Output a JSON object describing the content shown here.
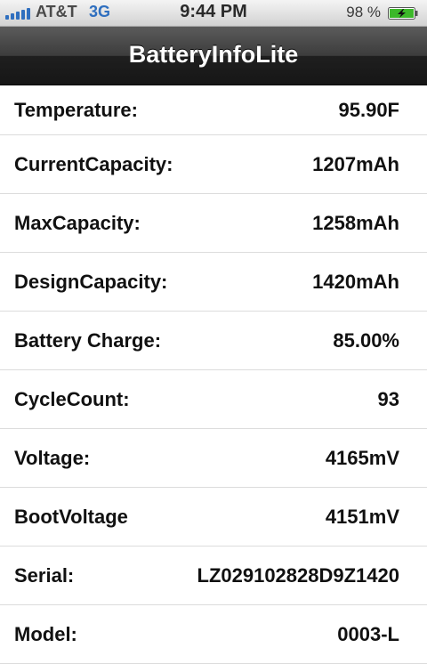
{
  "status_bar": {
    "carrier": "AT&T",
    "network": "3G",
    "time": "9:44 PM",
    "battery_percent": "98 %",
    "icons": [
      "signal-bars-icon",
      "battery-charging-icon"
    ]
  },
  "nav": {
    "title": "BatteryInfoLite"
  },
  "rows": [
    {
      "label": "Temperature:",
      "value": "95.90F"
    },
    {
      "label": "CurrentCapacity:",
      "value": "1207mAh"
    },
    {
      "label": "MaxCapacity:",
      "value": "1258mAh"
    },
    {
      "label": "DesignCapacity:",
      "value": "1420mAh"
    },
    {
      "label": "Battery Charge:",
      "value": "85.00%"
    },
    {
      "label": "CycleCount:",
      "value": "93"
    },
    {
      "label": "Voltage:",
      "value": "4165mV"
    },
    {
      "label": "BootVoltage",
      "value": "4151mV"
    },
    {
      "label": "Serial:",
      "value": "LZ029102828D9Z1420"
    },
    {
      "label": "Model:",
      "value": "0003-L"
    }
  ],
  "colors": {
    "nav_background": "#2b2b2b",
    "status_accent": "#2f6fbf",
    "battery_green": "#3cb829"
  }
}
